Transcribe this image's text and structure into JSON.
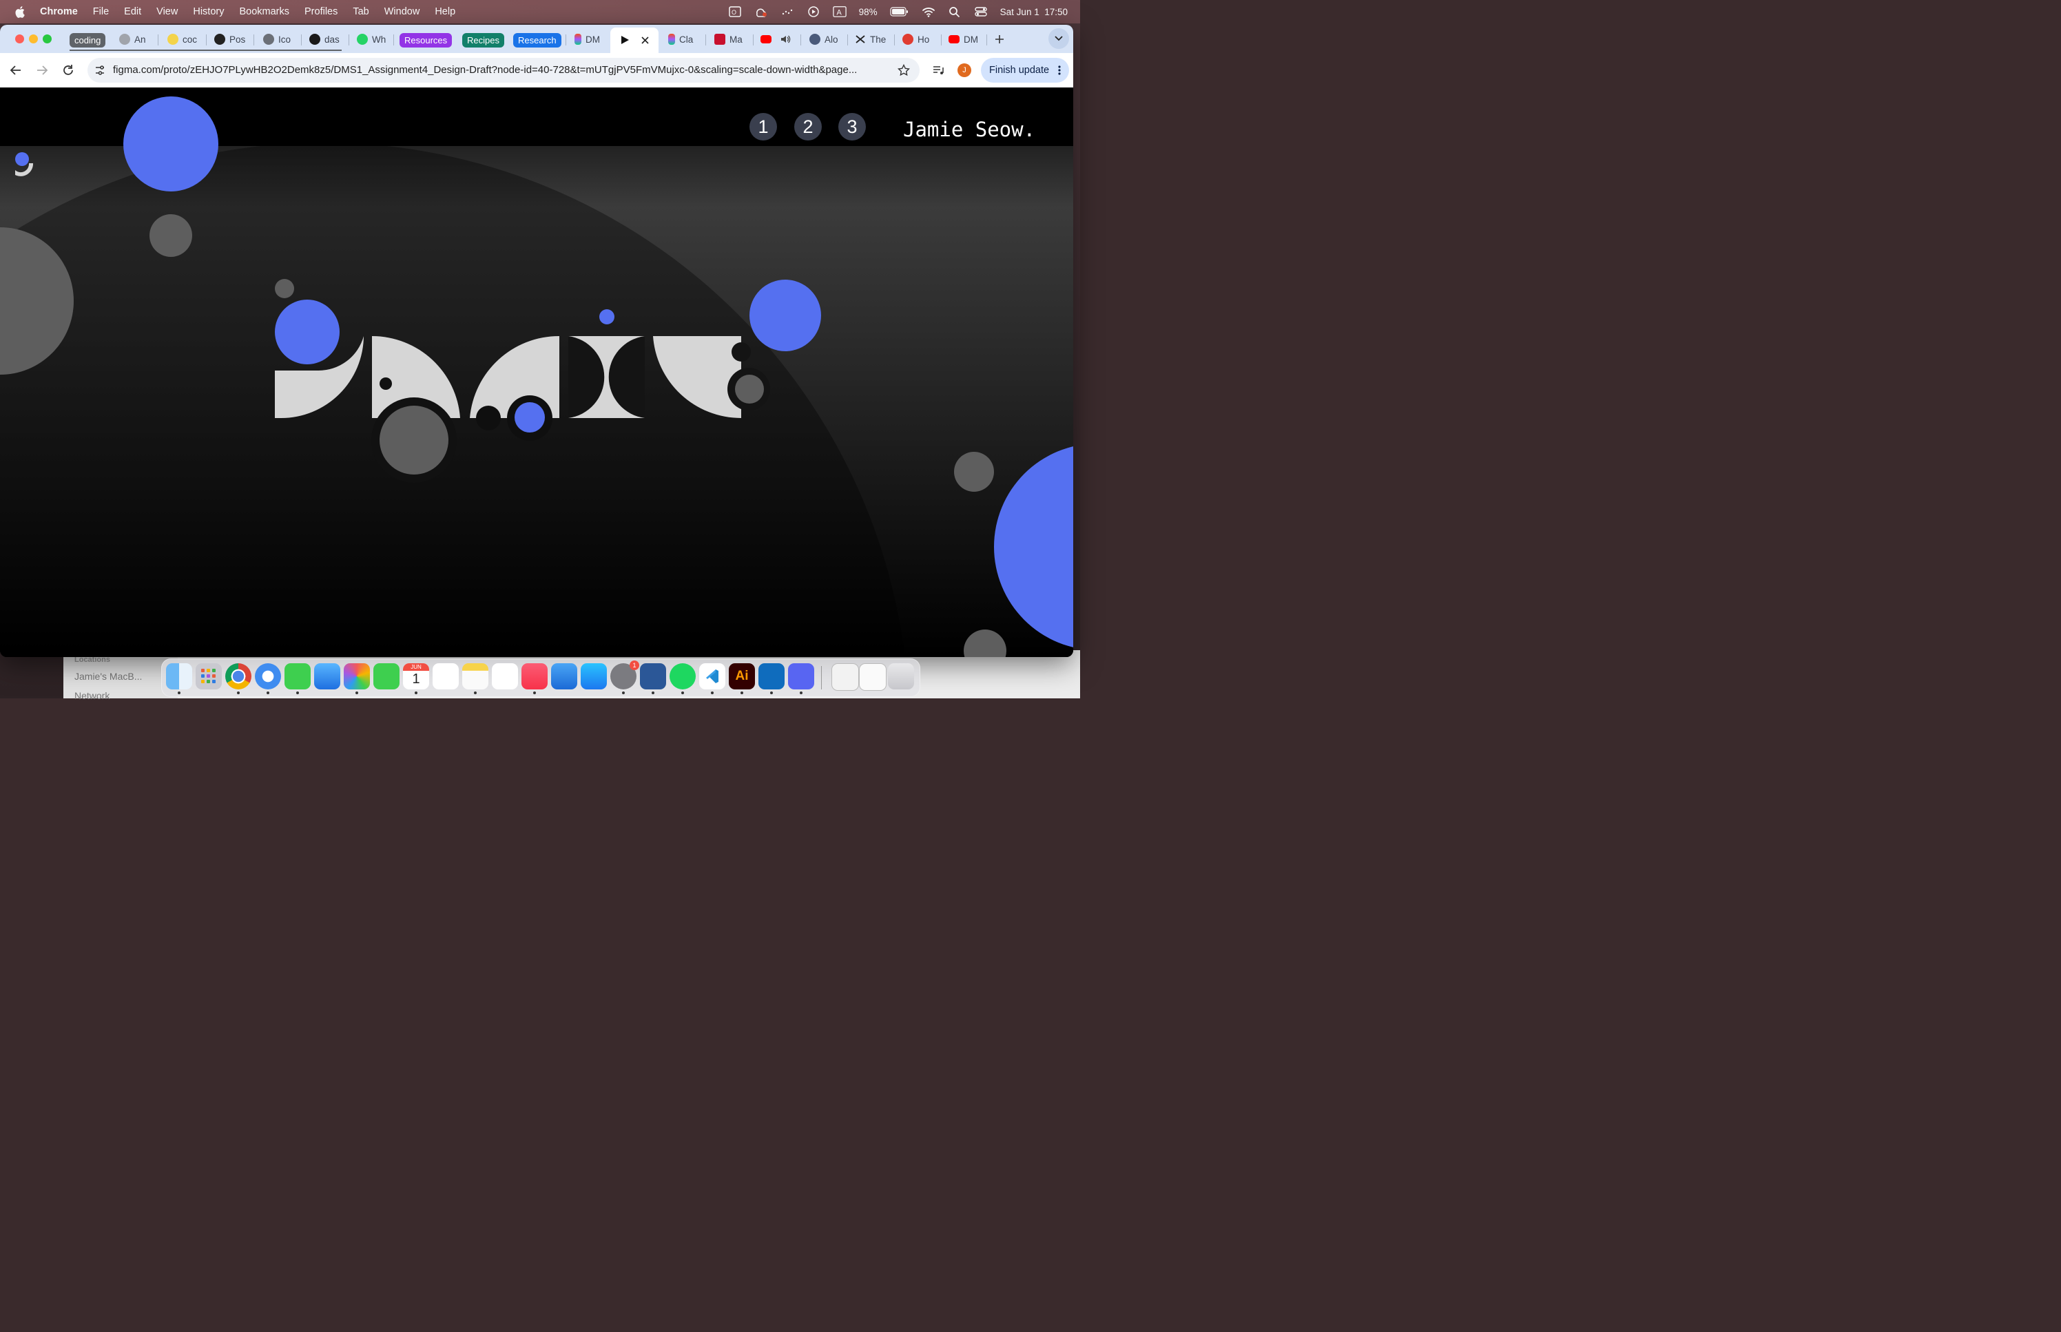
{
  "menubar": {
    "app": "Chrome",
    "items": [
      "File",
      "Edit",
      "View",
      "History",
      "Bookmarks",
      "Profiles",
      "Tab",
      "Window",
      "Help"
    ],
    "battery": "98%",
    "datetime": "Sat Jun 1  17:50"
  },
  "tabs": [
    {
      "label": "coding",
      "kind": "group-chip",
      "color": "#5f6368"
    },
    {
      "label": "An"
    },
    {
      "label": "coc"
    },
    {
      "label": "Pos"
    },
    {
      "label": "Ico"
    },
    {
      "label": "das"
    },
    {
      "label": "Wh"
    },
    {
      "label": "Resources",
      "kind": "group-chip",
      "color": "#9334e6"
    },
    {
      "label": "Recipes",
      "kind": "group-chip",
      "color": "#12806a"
    },
    {
      "label": "Research",
      "kind": "group-chip",
      "color": "#1a73e8"
    },
    {
      "label": "DM"
    },
    {
      "label": "Cla"
    },
    {
      "label": "Ma"
    },
    {
      "label": "Alo"
    },
    {
      "label": "The"
    },
    {
      "label": "Ho"
    },
    {
      "label": "DM"
    }
  ],
  "toolbar": {
    "url": "figma.com/proto/zEHJO7PLywHB2O2Demk8z5/DMS1_Assignment4_Design-Draft?node-id=40-728&t=mUTgjPV5FmVMujxc-0&scaling=scale-down-width&page...",
    "profile_initial": "J",
    "finish_update": "Finish update"
  },
  "page": {
    "nav": [
      "1",
      "2",
      "3"
    ],
    "brand": "Jamie Seow.",
    "colors": {
      "blue": "#5570f0",
      "grey": "#5e5e5e",
      "light": "#d6d6d6"
    }
  },
  "finder": {
    "locations": "Locations",
    "mac": "Jamie's MacB...",
    "network": "Network"
  },
  "dock": {
    "calendar_month": "JUN",
    "calendar_day": "1",
    "settings_badge": "1",
    "illustrator_label": "Ai"
  }
}
